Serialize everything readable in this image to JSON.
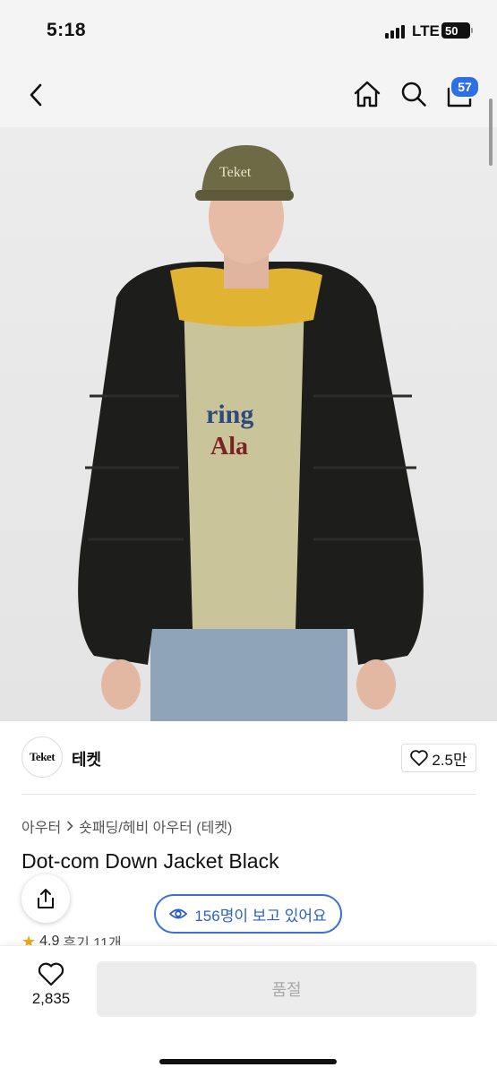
{
  "status": {
    "time": "5:18",
    "network": "LTE",
    "battery": "50"
  },
  "nav": {
    "cart_count": "57"
  },
  "brand": {
    "logo_text": "Teket",
    "name": "테켓",
    "likes": "2.5만"
  },
  "breadcrumb": {
    "category": "아우터",
    "subcategory": "숏패딩/헤비 아우터 (테켓)"
  },
  "product": {
    "title": "Dot-com Down Jacket Black",
    "rating": "4.9",
    "reviews": "후기 11개"
  },
  "viewers": {
    "text": "156명이 보고 있어요"
  },
  "bottom": {
    "wish_count": "2,835",
    "buy_label": "품절"
  },
  "colors": {
    "accent": "#2f6fe4",
    "star": "#f2a516",
    "disabled_bg": "#ececec"
  }
}
